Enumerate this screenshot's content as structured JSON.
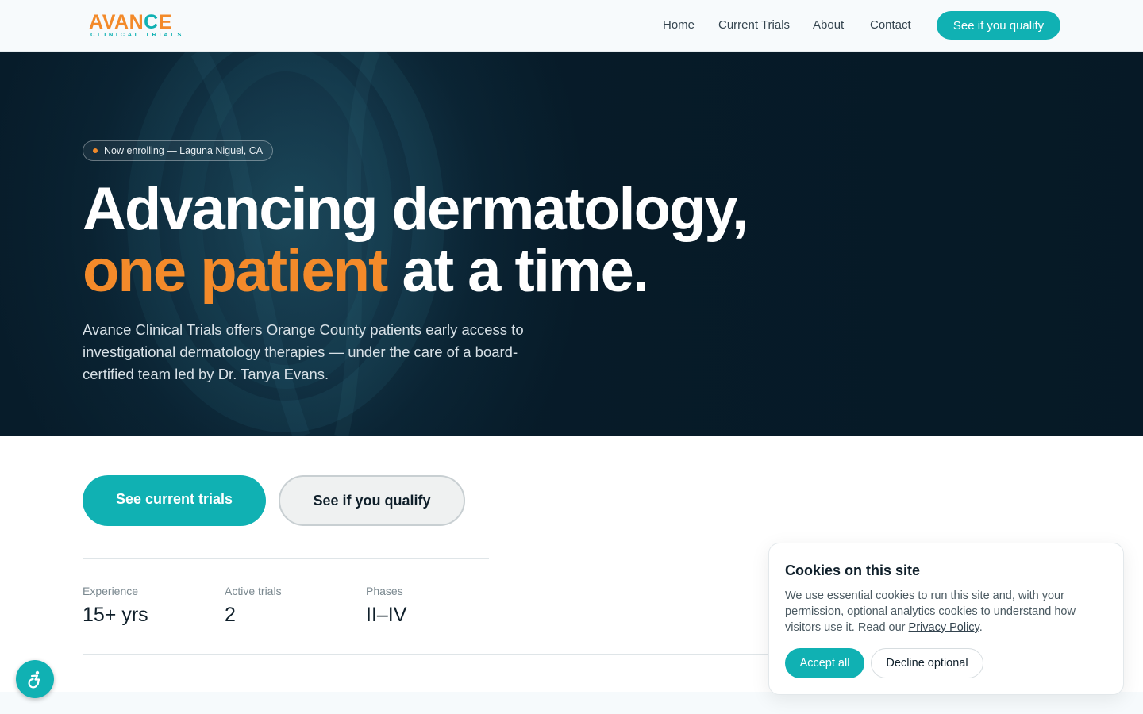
{
  "header": {
    "logo": {
      "wordmark_left": "AVAN",
      "wordmark_c": "C",
      "wordmark_right": "E",
      "tagline": "CLINICAL TRIALS"
    },
    "nav": [
      "Home",
      "Current Trials",
      "About",
      "Contact"
    ],
    "cta": "See if you qualify"
  },
  "hero": {
    "badge": "Now enrolling — Laguna Niguel, CA",
    "title_line1": "Advancing dermatology,",
    "title_accent": "one patient",
    "title_rest": " at a time.",
    "lead": "Avance Clinical Trials offers Orange County patients early access to investigational dermatology therapies — under the care of a board-certified team led by Dr. Tanya Evans."
  },
  "actions": {
    "primary": "See current trials",
    "secondary": "See if you qualify"
  },
  "stats": [
    {
      "label": "Experience",
      "value": "15+ yrs"
    },
    {
      "label": "Active trials",
      "value": "2"
    },
    {
      "label": "Phases",
      "value": "II–IV"
    }
  ],
  "cookie": {
    "title": "Cookies on this site",
    "text": "We use essential cookies to run this site and, with your permission, optional analytics cookies to understand how visitors use it. Read our ",
    "link": "Privacy Policy",
    "text_end": ".",
    "accept": "Accept all",
    "decline": "Decline optional"
  },
  "colors": {
    "brand_teal": "#10b1b3",
    "brand_orange": "#f38a2a",
    "hero_bg": "#0b2535"
  },
  "icons": {
    "accessibility": "accessibility-icon",
    "badge_dot": "status-dot-icon"
  }
}
